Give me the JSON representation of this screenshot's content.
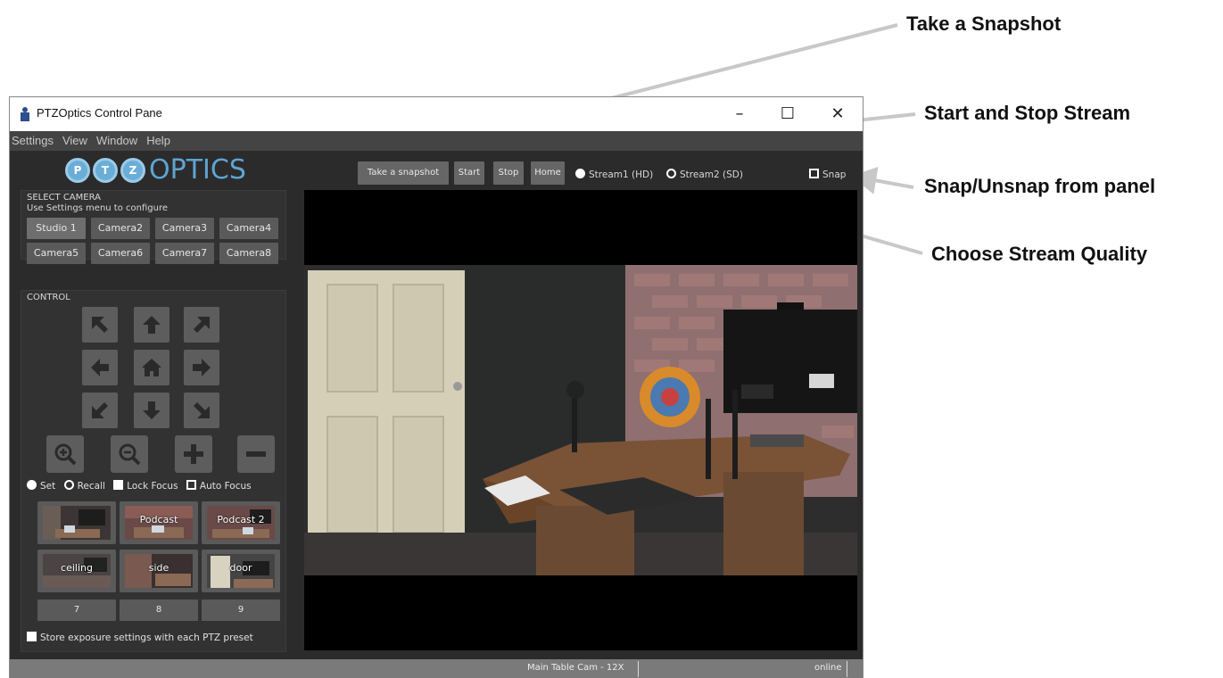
{
  "annotations": {
    "snapshot": "Take a Snapshot",
    "stream": "Start and Stop Stream",
    "snap": "Snap/Unsnap from panel",
    "quality": "Choose Stream Quality"
  },
  "window": {
    "title": "PTZOptics Control Pane",
    "minimize": "–",
    "maximize": "☐",
    "close": "✕"
  },
  "menu": [
    "Settings",
    "View",
    "Window",
    "Help"
  ],
  "logo": {
    "letters": [
      "P",
      "T",
      "Z"
    ],
    "word": "OPTICS"
  },
  "toolbar": {
    "snapshot": "Take a snapshot",
    "start": "Start",
    "stop": "Stop",
    "home": "Home",
    "stream1": "Stream1 (HD)",
    "stream2": "Stream2 (SD)",
    "snap": "Snap"
  },
  "select_camera": {
    "title": "SELECT CAMERA",
    "hint": "Use Settings menu to configure",
    "cameras": [
      "Studio 1",
      "Camera2",
      "Camera3",
      "Camera4",
      "Camera5",
      "Camera6",
      "Camera7",
      "Camera8"
    ]
  },
  "control": {
    "title": "CONTROL",
    "pad_icons": [
      "arrow-up-left-icon",
      "arrow-up-icon",
      "arrow-up-right-icon",
      "arrow-left-icon",
      "home-icon",
      "arrow-right-icon",
      "arrow-down-left-icon",
      "arrow-down-icon",
      "arrow-down-right-icon"
    ],
    "zoom_icons": [
      "zoom-in-icon",
      "zoom-out-icon",
      "plus-icon",
      "minus-icon"
    ],
    "set": "Set",
    "recall": "Recall",
    "lock_focus": "Lock Focus",
    "auto_focus": "Auto Focus",
    "presets": [
      "",
      "Podcast",
      "Podcast 2",
      "ceiling",
      "side",
      "door"
    ],
    "numbered": [
      "7",
      "8",
      "9"
    ],
    "store_exposure": "Store exposure settings with each PTZ preset"
  },
  "status": {
    "camera": "Main Table Cam - 12X",
    "state": "online"
  },
  "colors": {
    "accent": "#5fa4d3",
    "panel": "#2b2b2b",
    "button": "#5d5d5d"
  }
}
